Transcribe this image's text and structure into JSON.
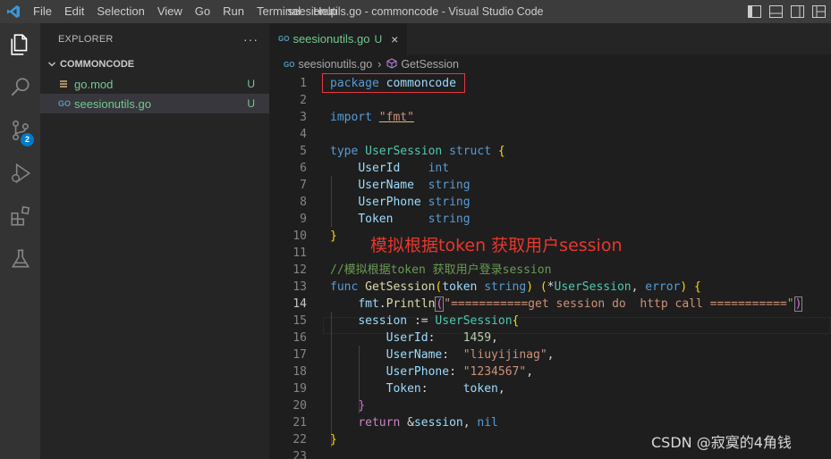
{
  "titlebar": {
    "menu": [
      "File",
      "Edit",
      "Selection",
      "View",
      "Go",
      "Run",
      "Terminal",
      "Help"
    ],
    "window_title": "seesionutils.go - commoncode - Visual Studio Code"
  },
  "activity_bar": {
    "items": [
      "explorer-icon",
      "search-icon",
      "source-control-icon",
      "run-debug-icon",
      "extensions-icon",
      "testing-icon"
    ],
    "source_control_badge": "2"
  },
  "sidebar": {
    "title": "EXPLORER",
    "more": "···",
    "folder": "COMMONCODE",
    "files": [
      {
        "icon": "go-mod-icon",
        "name": "go.mod",
        "status": "U"
      },
      {
        "icon": "go-file-icon",
        "name": "seesionutils.go",
        "status": "U"
      }
    ]
  },
  "editor": {
    "tab": {
      "icon_text": "GO",
      "name": "seesionutils.go",
      "status": "U",
      "close": "×"
    },
    "breadcrumbs": {
      "file_icon_text": "GO",
      "file": "seesionutils.go",
      "separator": "›",
      "symbol": "GetSession"
    },
    "active_line": 14,
    "lines": [
      "package commoncode",
      "",
      "import \"fmt\"",
      "",
      "type UserSession struct {",
      "    UserId    int",
      "    UserName  string",
      "    UserPhone string",
      "    Token     string",
      "}",
      "",
      "//模拟根据token 获取用户登录session",
      "func GetSession(token string) (*UserSession, error) {",
      "    fmt.Println(\"===========get session do  http call ===========\")",
      "    session := UserSession{",
      "        UserId:    1459,",
      "        UserName:  \"liuyijinag\",",
      "        UserPhone: \"1234567\",",
      "        Token:     token,",
      "    }",
      "    return &session, nil",
      "}",
      ""
    ]
  },
  "annotation": "模拟根据token 获取用户session",
  "watermark": "CSDN @寂寞的4角钱",
  "colors": {
    "accent": "#007acc",
    "untracked": "#73c991",
    "annotation_red": "#e8372e"
  }
}
